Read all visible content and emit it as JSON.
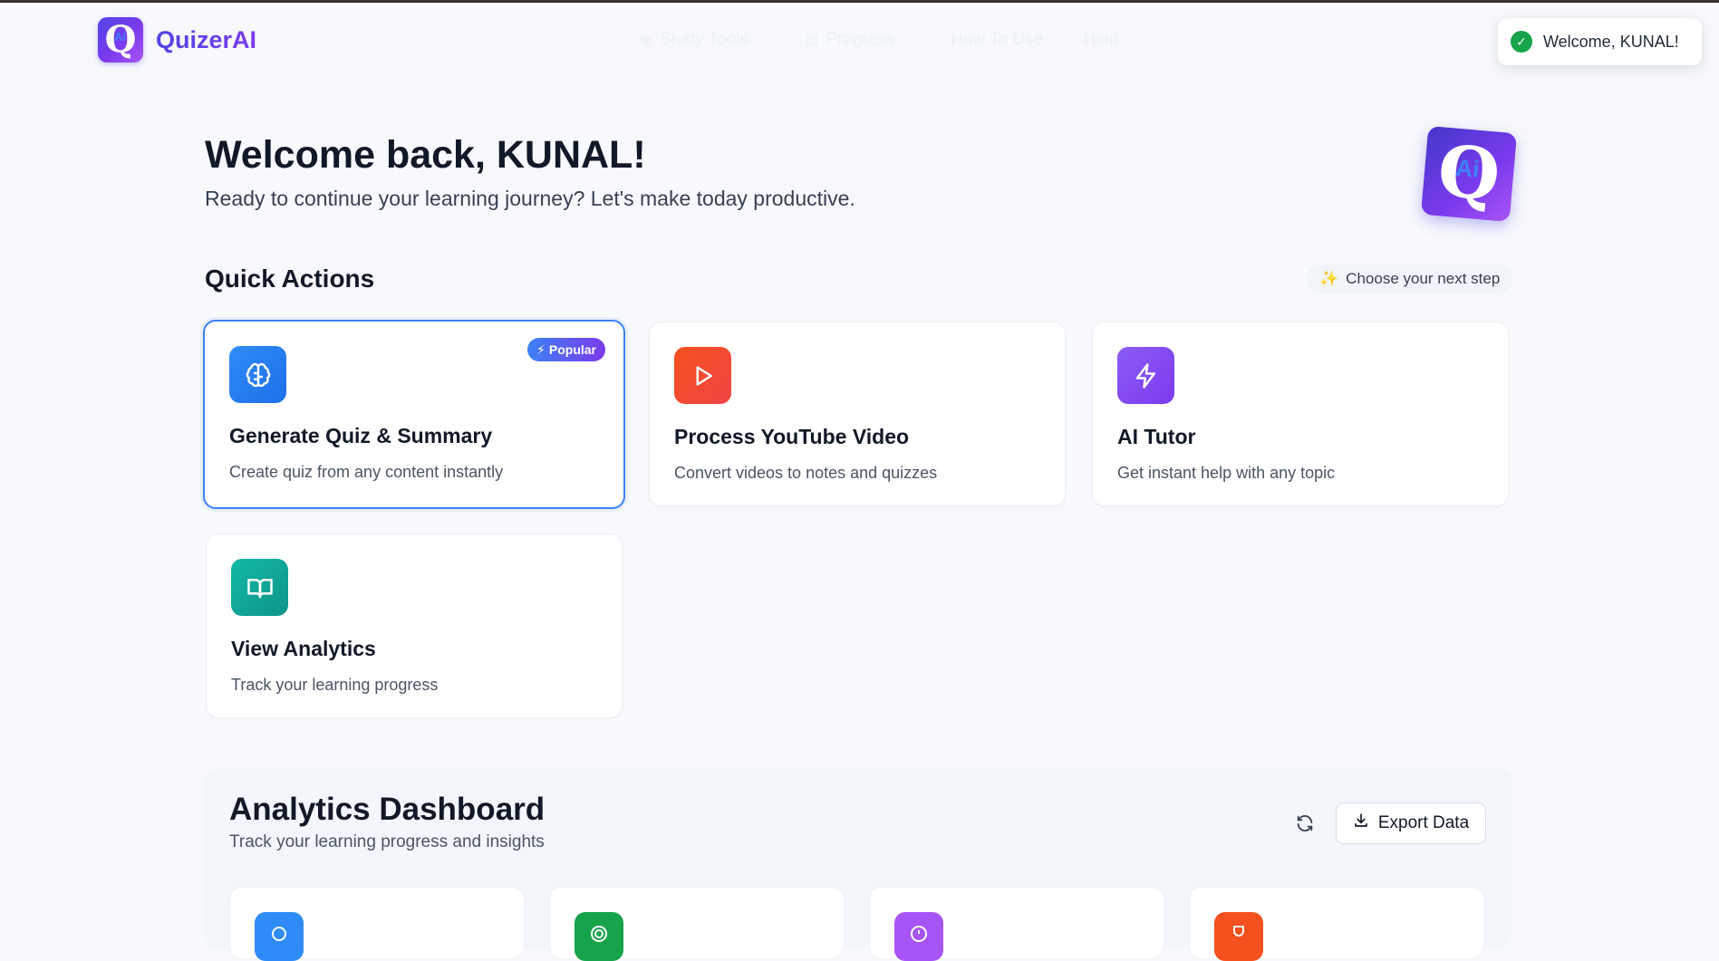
{
  "app": {
    "name": "QuizerAI",
    "logo_letter": "Q",
    "logo_sub": "Ai"
  },
  "nav": [
    {
      "label": "Study Tools",
      "icon": "book-icon",
      "has_dropdown": true
    },
    {
      "label": "Progress",
      "icon": "chart-icon",
      "has_dropdown": true
    },
    {
      "label": "How To Use",
      "has_dropdown": false
    },
    {
      "label": "Help",
      "has_dropdown": false
    }
  ],
  "toast": {
    "message": "Welcome, KUNAL!"
  },
  "welcome": {
    "title": "Welcome back, KUNAL!",
    "subtitle": "Ready to continue your learning journey? Let's make today productive."
  },
  "quick_actions": {
    "title": "Quick Actions",
    "hint": "Choose your next step",
    "cards": [
      {
        "title": "Generate Quiz & Summary",
        "desc": "Create quiz from any content instantly",
        "badge": "Popular",
        "icon": "brain-icon",
        "color": "#2f8cf7"
      },
      {
        "title": "Process YouTube Video",
        "desc": "Convert videos to notes and quizzes",
        "icon": "play-icon",
        "color": "#f4511e"
      },
      {
        "title": "AI Tutor",
        "desc": "Get instant help with any topic",
        "icon": "zap-icon",
        "color": "#8b5cf6"
      },
      {
        "title": "View Analytics",
        "desc": "Track your learning progress",
        "icon": "open-book-icon",
        "color": "#14b8a6"
      }
    ]
  },
  "analytics": {
    "title": "Analytics Dashboard",
    "subtitle": "Track your learning progress and insights",
    "export_label": "Export Data",
    "stat_colors": [
      "#2f8cf7",
      "#16a34a",
      "#a855f7",
      "#f4511e"
    ]
  }
}
